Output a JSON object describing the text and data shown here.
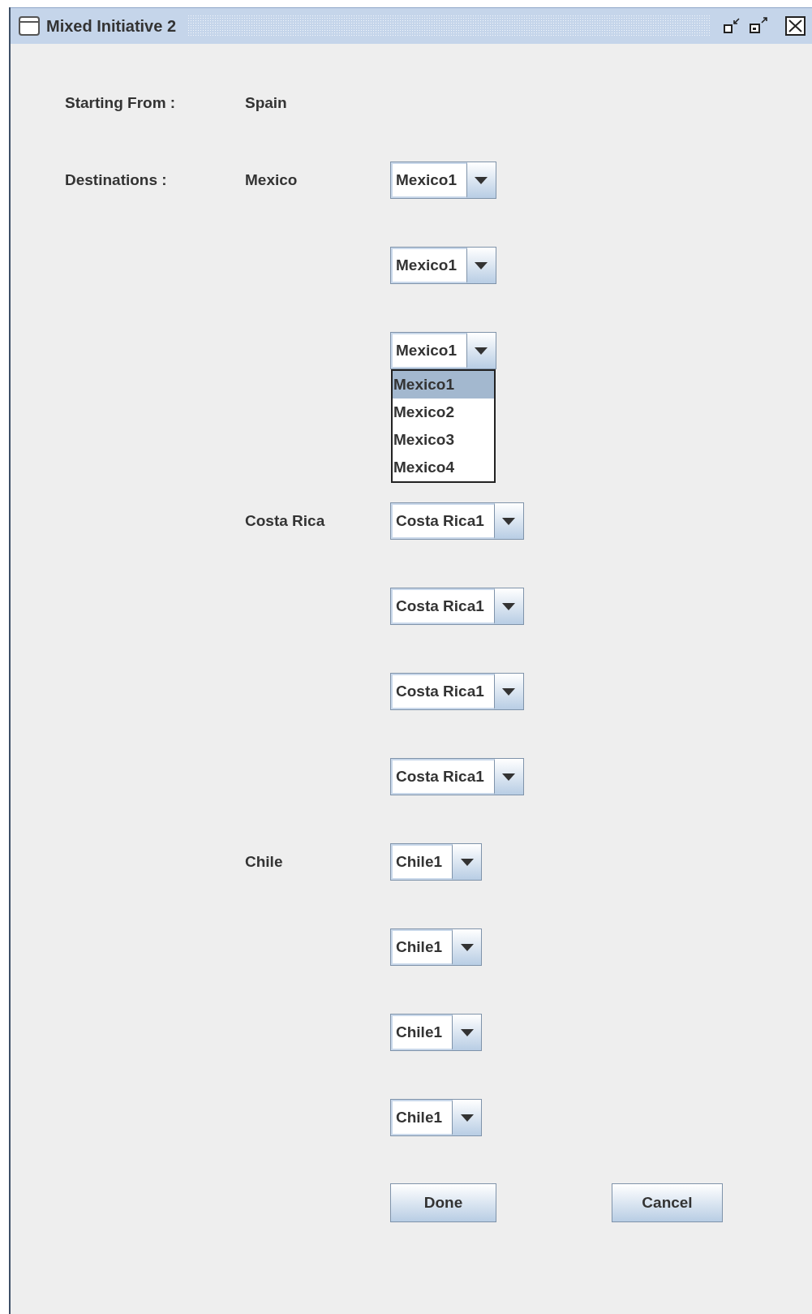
{
  "window": {
    "title": "Mixed Initiative 2"
  },
  "starting_from": {
    "label": "Starting From :",
    "value": "Spain"
  },
  "destinations": {
    "label": "Destinations :",
    "groups": [
      {
        "country": "Mexico",
        "combos": [
          {
            "value": "Mexico1"
          },
          {
            "value": "Mexico1"
          },
          {
            "value": "Mexico1",
            "expanded": true,
            "options": [
              {
                "label": "Mexico1",
                "selected": true
              },
              {
                "label": "Mexico2",
                "selected": false
              },
              {
                "label": "Mexico3",
                "selected": false
              },
              {
                "label": "Mexico4",
                "selected": false
              }
            ]
          }
        ]
      },
      {
        "country": "Costa Rica",
        "combos": [
          {
            "value": "Costa Rica1"
          },
          {
            "value": "Costa Rica1"
          },
          {
            "value": "Costa Rica1"
          },
          {
            "value": "Costa Rica1"
          }
        ]
      },
      {
        "country": "Chile",
        "combos": [
          {
            "value": "Chile1"
          },
          {
            "value": "Chile1"
          },
          {
            "value": "Chile1"
          },
          {
            "value": "Chile1"
          }
        ]
      }
    ]
  },
  "buttons": [
    {
      "label": "Done"
    },
    {
      "label": "Cancel"
    }
  ]
}
